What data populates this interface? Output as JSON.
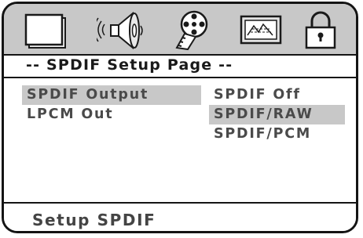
{
  "icons": [
    {
      "name": "tv-screen-icon"
    },
    {
      "name": "speaker-icon"
    },
    {
      "name": "film-reel-icon"
    },
    {
      "name": "picture-icon"
    },
    {
      "name": "padlock-icon"
    }
  ],
  "title": "-- SPDIF Setup Page --",
  "left_menu": [
    {
      "label": "SPDIF Output",
      "selected": true
    },
    {
      "label": "LPCM Out",
      "selected": false
    }
  ],
  "right_menu": [
    {
      "label": "SPDIF Off",
      "selected": false
    },
    {
      "label": "SPDIF/RAW",
      "selected": true
    },
    {
      "label": "SPDIF/PCM",
      "selected": false
    }
  ],
  "status": "Setup SPDIF",
  "colors": {
    "highlight": "#c8c8c8",
    "border": "#141414",
    "text": "#4a4a4a"
  }
}
